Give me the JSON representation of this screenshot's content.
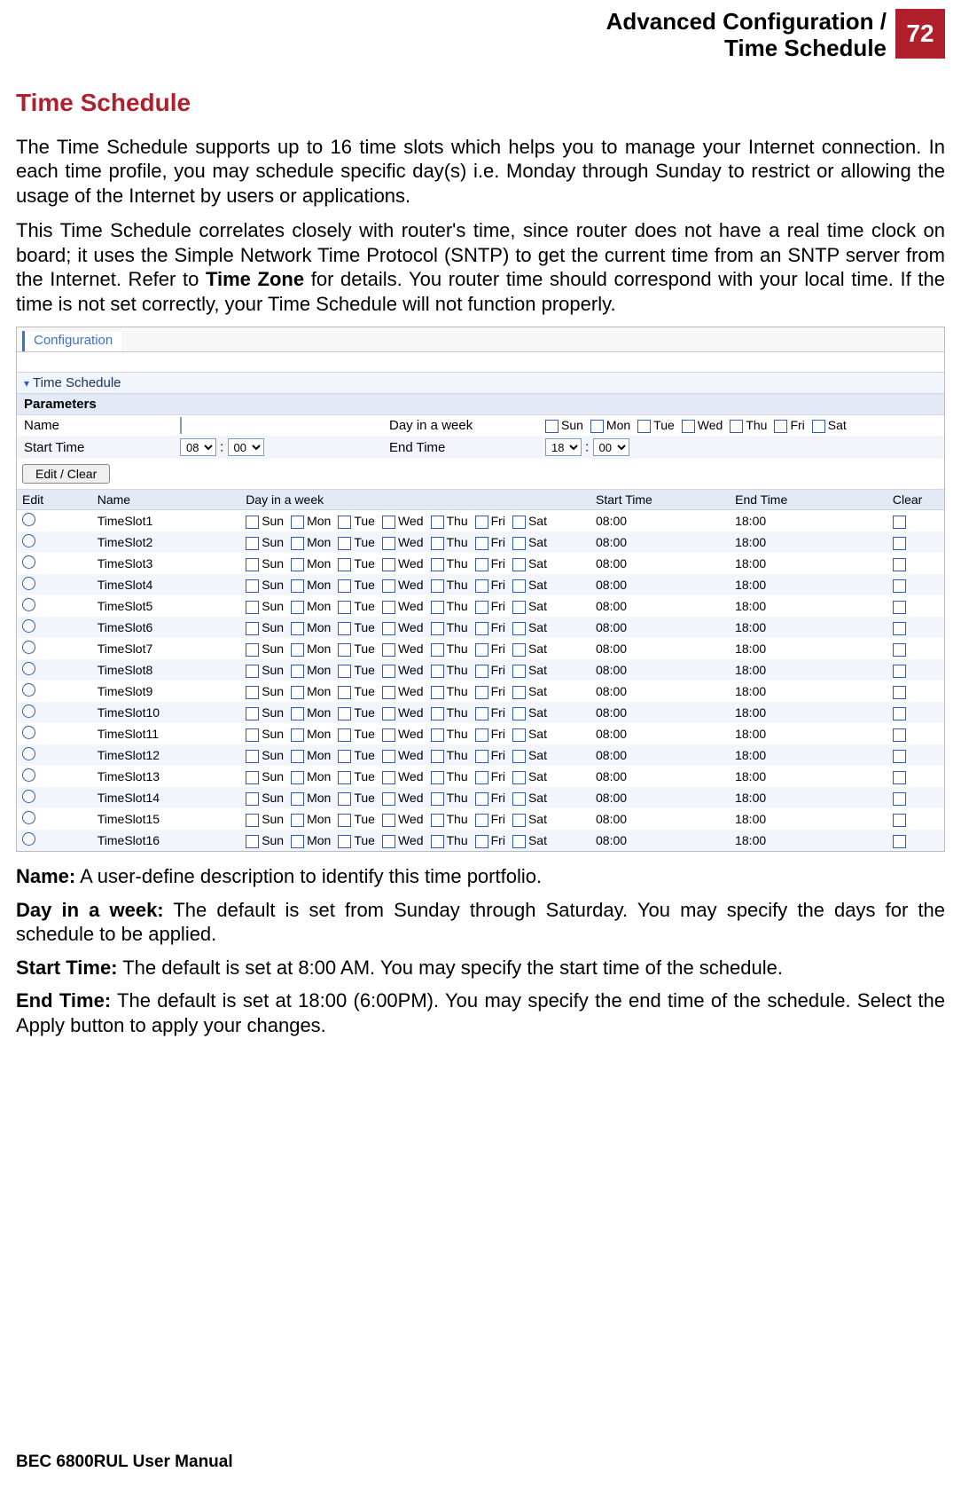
{
  "header": {
    "crumb1": "Advanced Configuration /",
    "crumb2": "Time Schedule",
    "page_num": "72"
  },
  "section_title": "Time Schedule",
  "intro_p1": "The Time Schedule supports up to 16 time slots which helps you to manage your Internet connection.  In each time profile, you may schedule specific day(s) i.e. Monday through Sunday to restrict or allowing the usage of the Internet by users or applications.",
  "intro_p2a": "This Time Schedule correlates closely with router's time, since router does not have a real time clock on board; it uses the Simple Network Time Protocol (SNTP) to get the current time from an SNTP server from the Internet. Refer to ",
  "intro_p2b_bold": "Time Zone",
  "intro_p2c": " for details.  You router time should correspond with your local time.  If the time is not set correctly, your Time Schedule will not function properly.",
  "ui": {
    "tab": "Configuration",
    "panel": "Time Schedule",
    "param_header": "Parameters",
    "row1_l1": "Name",
    "row1_l2": "Day in a week",
    "row2_l1": "Start Time",
    "row2_l2": "End Time",
    "start_h": "08",
    "start_m": "00",
    "end_h": "18",
    "end_m": "00",
    "colon": ":",
    "days": [
      "Sun",
      "Mon",
      "Tue",
      "Wed",
      "Thu",
      "Fri",
      "Sat"
    ],
    "btn_edit": "Edit / Clear",
    "grid_headers": {
      "edit": "Edit",
      "name": "Name",
      "day": "Day in a week",
      "st": "Start Time",
      "et": "End Time",
      "clr": "Clear"
    },
    "slots": [
      {
        "name": "TimeSlot1",
        "st": "08:00",
        "et": "18:00"
      },
      {
        "name": "TimeSlot2",
        "st": "08:00",
        "et": "18:00"
      },
      {
        "name": "TimeSlot3",
        "st": "08:00",
        "et": "18:00"
      },
      {
        "name": "TimeSlot4",
        "st": "08:00",
        "et": "18:00"
      },
      {
        "name": "TimeSlot5",
        "st": "08:00",
        "et": "18:00"
      },
      {
        "name": "TimeSlot6",
        "st": "08:00",
        "et": "18:00"
      },
      {
        "name": "TimeSlot7",
        "st": "08:00",
        "et": "18:00"
      },
      {
        "name": "TimeSlot8",
        "st": "08:00",
        "et": "18:00"
      },
      {
        "name": "TimeSlot9",
        "st": "08:00",
        "et": "18:00"
      },
      {
        "name": "TimeSlot10",
        "st": "08:00",
        "et": "18:00"
      },
      {
        "name": "TimeSlot11",
        "st": "08:00",
        "et": "18:00"
      },
      {
        "name": "TimeSlot12",
        "st": "08:00",
        "et": "18:00"
      },
      {
        "name": "TimeSlot13",
        "st": "08:00",
        "et": "18:00"
      },
      {
        "name": "TimeSlot14",
        "st": "08:00",
        "et": "18:00"
      },
      {
        "name": "TimeSlot15",
        "st": "08:00",
        "et": "18:00"
      },
      {
        "name": "TimeSlot16",
        "st": "08:00",
        "et": "18:00"
      }
    ]
  },
  "defs": {
    "name_l": "Name:",
    "name_t": " A user-define description to identify this time portfolio.",
    "day_l": "Day in a week:",
    "day_t": " The default is set from Sunday through Saturday. You may specify the days for the schedule to be applied.",
    "st_l": "Start Time:",
    "st_t": " The default is set at 8:00 AM.  You may specify the start time of the schedule.",
    "et_l": "End Time:",
    "et_t": " The default is set at 18:00 (6:00PM). You may specify the end time of the schedule. Select the Apply button to apply your changes."
  },
  "footer": "BEC 6800RUL User Manual"
}
